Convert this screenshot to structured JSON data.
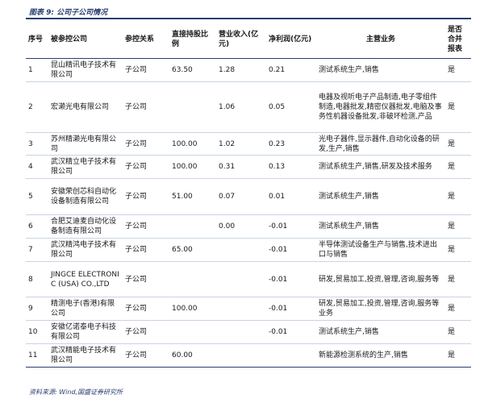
{
  "title": "图表 9:  公司子公司情况",
  "headers": {
    "no": "序号",
    "company": "被参控公司",
    "relation": "参控关系",
    "ratio": "直接持股比例",
    "revenue": "营业收入(亿元)",
    "profit": "净利润(亿元)",
    "business": "主营业务",
    "consolidated": "是否合并报表"
  },
  "rows": [
    {
      "no": "1",
      "company": "昆山精讯电子技术有限公司",
      "relation": "子公司",
      "ratio": "63.50",
      "revenue": "1.28",
      "profit": "0.21",
      "business": "测试系统生产,销售",
      "consolidated": "是"
    },
    {
      "no": "2",
      "company": "宏濑光电有限公司",
      "relation": "子公司",
      "ratio": "",
      "revenue": "1.06",
      "profit": "0.05",
      "business": "电器及视听电子产品制造,电子零组件制造,电器批发,精密仪器批发,电脑及事务性机器设备批发,非破坏检测,产品",
      "consolidated": "是"
    },
    {
      "no": "3",
      "company": "苏州精濑光电有限公司",
      "relation": "子公司",
      "ratio": "100.00",
      "revenue": "1.02",
      "profit": "0.23",
      "business": "光电子器件,显示器件,自动化设备的研发,生产,销售",
      "consolidated": "是"
    },
    {
      "no": "4",
      "company": "武汉精立电子技术有限公司",
      "relation": "子公司",
      "ratio": "100.00",
      "revenue": "0.31",
      "profit": "0.13",
      "business": "测试系统生产,销售,研发及技术服务",
      "consolidated": "是"
    },
    {
      "no": "5",
      "company": "安徽荣创芯科自动化设备制造有限公司",
      "relation": "子公司",
      "ratio": "51.00",
      "revenue": "0.07",
      "profit": "0.01",
      "business": "测试系统生产,销售",
      "consolidated": "是"
    },
    {
      "no": "6",
      "company": "合肥艾迪麦自动化设备制造有限公司",
      "relation": "子公司",
      "ratio": "",
      "revenue": "0.00",
      "profit": "-0.01",
      "business": "测试系统生产,销售",
      "consolidated": "是"
    },
    {
      "no": "7",
      "company": "武汉精鸿电子技术有限公司",
      "relation": "子公司",
      "ratio": "65.00",
      "revenue": "",
      "profit": "-0.01",
      "business": "半导体测试设备生产与销售,技术进出口与销售",
      "consolidated": "是"
    },
    {
      "no": "8",
      "company": "JINGCE ELECTRONIC (USA) CO.,LTD",
      "relation": "子公司",
      "ratio": "",
      "revenue": "",
      "profit": "-0.01",
      "business": "研发,贸易加工,投资,管理,咨询,服务等",
      "consolidated": "是"
    },
    {
      "no": "9",
      "company": "精测电子(香港)有限公司",
      "relation": "子公司",
      "ratio": "100.00",
      "revenue": "",
      "profit": "-0.01",
      "business": "研发,贸易加工,投资,管理,咨询,服务等业务",
      "consolidated": "是"
    },
    {
      "no": "10",
      "company": "安徽亿诺泰电子科技有限公司",
      "relation": "子公司",
      "ratio": "",
      "revenue": "",
      "profit": "-0.01",
      "business": "测试系统生产,销售",
      "consolidated": "是"
    },
    {
      "no": "11",
      "company": "武汉精能电子技术有限公司",
      "relation": "子公司",
      "ratio": "60.00",
      "revenue": "",
      "profit": "",
      "business": "新能源检测系统的生产,销售",
      "consolidated": "是"
    }
  ],
  "source": "资料来源:  Wind,国盛证券研究所"
}
